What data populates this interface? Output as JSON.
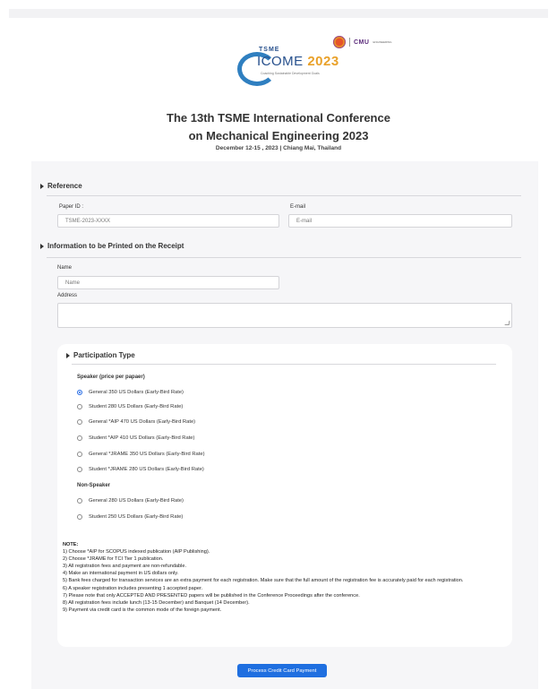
{
  "header": {
    "partner_text": "CMU",
    "partner_sub": "ENGINEERING",
    "logo_tsme": "TSME",
    "logo_icome": "ICOME",
    "logo_year": "2023",
    "logo_tagline": "Coaching Sustainable Development Goals",
    "title_line1": "The 13th TSME International Conference",
    "title_line2": "on Mechanical Engineering 2023",
    "date_location": "December 12-15 , 2023 | Chiang Mai, Thailand"
  },
  "reference": {
    "heading": "Reference",
    "paper_id_label": "Paper ID :",
    "paper_id_placeholder": "TSME-2023-XXXX",
    "email_label": "E-mail",
    "email_placeholder": "E-mail"
  },
  "receipt": {
    "heading": "Information to be Printed on the Receipt",
    "name_label": "Name",
    "name_placeholder": "Name",
    "address_label": "Address"
  },
  "participation": {
    "heading": "Participation Type",
    "speaker_heading": "Speaker (price per papaer)",
    "speaker_options": [
      {
        "label": "General 350 US Dollars (Early-Bird Rate)",
        "selected": true
      },
      {
        "label": "Student 280 US Dollars (Early-Bird Rate)",
        "selected": false
      },
      {
        "label": "General *AIP 470 US Dollars (Early-Bird Rate)",
        "selected": false
      },
      {
        "label": "Student *AIP 410 US Dollars (Early-Bird Rate)",
        "selected": false
      },
      {
        "label": "General *JRAME 350 US Dollars (Early-Bird Rate)",
        "selected": false
      },
      {
        "label": "Student *JRAME 280 US Dollars (Early-Bird Rate)",
        "selected": false
      }
    ],
    "nonspeaker_heading": "Non-Speaker",
    "nonspeaker_options": [
      {
        "label": "General 280 US Dollars (Early-Bird Rate)",
        "selected": false
      },
      {
        "label": "Student 250 US Dollars (Early-Bird Rate)",
        "selected": false
      }
    ]
  },
  "notes": {
    "heading": "NOTE:",
    "items": [
      "1) Choose *AIP for SCOPUS indexed publication (AIP Publishing).",
      "2) Choose *JRAME for TCI Tier 1 publication.",
      "3) All registration fees and payment are non-refundable.",
      "4) Make an international payment in US dollars only.",
      "5) Bank fees charged for transaction services are an extra payment for each registration. Make sure that the full amount of the registration fee is accurately paid for each registration.",
      "6) A speaker registration includes presenting 1 accepted paper.",
      "7) Please note that only ACCEPTED AND PRESENTED papers will be published in the Conference Proceedings after the conference.",
      "8) All registration fees include lunch (13-15 December) and Banquet (14 December).",
      "9) Payment via credit card is the common mode of the foreign payment."
    ]
  },
  "actions": {
    "pay_label": "Process Credit Card Payment"
  },
  "colors": {
    "accent": "#1f6fe0",
    "logo_blue": "#27508d",
    "logo_gold": "#e9a12a"
  }
}
